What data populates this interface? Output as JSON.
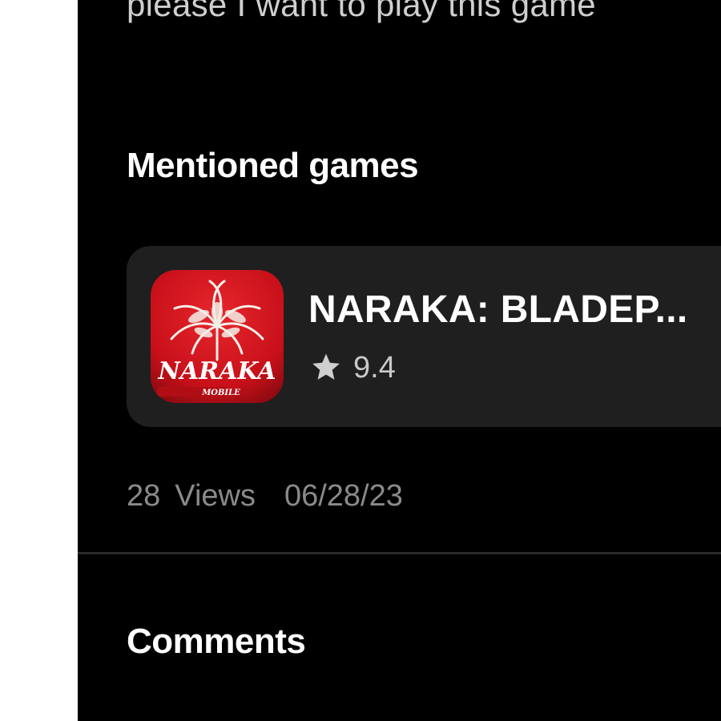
{
  "post": {
    "text": "please I want to play this game"
  },
  "mentioned_games": {
    "title": "Mentioned games",
    "items": [
      {
        "name": "NARAKA: BLADEP...",
        "rating": "9.4",
        "icon": "naraka-mobile-app-icon",
        "icon_logo_text": "NARAKA",
        "icon_sub_text": "MOBILE"
      }
    ]
  },
  "meta": {
    "views_count": "28",
    "views_label": "Views",
    "date": "06/28/23"
  },
  "comments": {
    "title": "Comments"
  },
  "colors": {
    "background": "#000000",
    "card": "#1f1f1f",
    "icon_red": "#d0141c"
  }
}
